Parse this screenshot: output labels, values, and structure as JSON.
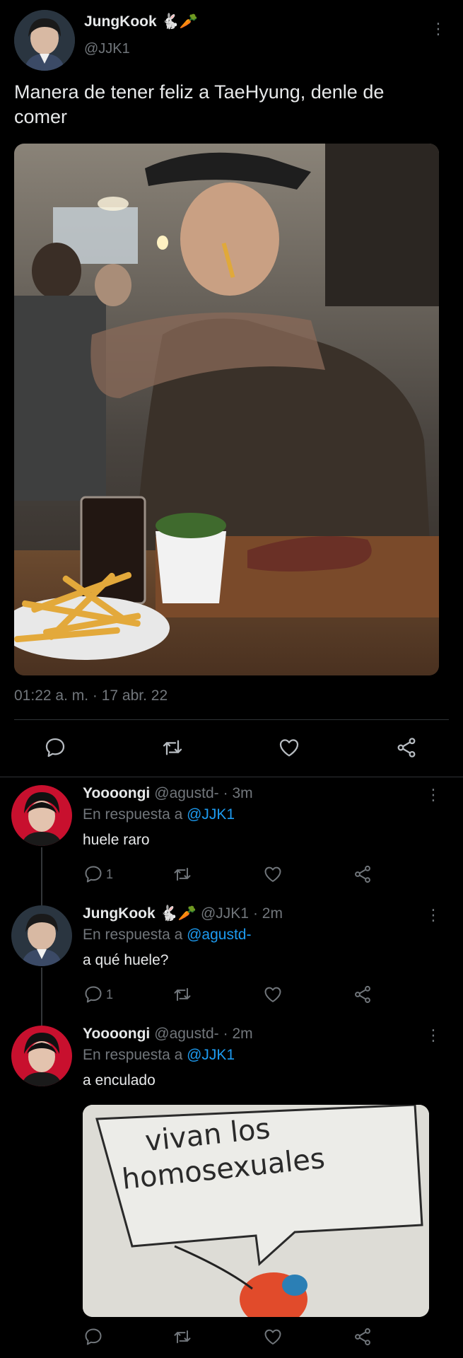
{
  "main_tweet": {
    "display_name": "JungKook",
    "name_emoji": "🐇🥕",
    "handle": "@JJK1",
    "text": "Manera de tener feliz a TaeHyung, denle de comer",
    "timestamp": "01:22 a. m. · 17 abr. 22",
    "more_label": "⋮"
  },
  "replies": [
    {
      "display_name": "Yoooongi",
      "name_emoji": "",
      "handle": "@agustd-",
      "time": "· 3m",
      "reply_prefix": "En respuesta a",
      "reply_to": "@JJK1",
      "text": "huele raro",
      "reply_count": "1",
      "more_label": "⋮"
    },
    {
      "display_name": "JungKook",
      "name_emoji": "🐇🥕",
      "handle": "@JJK1",
      "time": "· 2m",
      "reply_prefix": "En respuesta a",
      "reply_to": "@agustd-",
      "text": "a qué huele?",
      "reply_count": "1",
      "more_label": "⋮"
    },
    {
      "display_name": "Yoooongi",
      "name_emoji": "",
      "handle": "@agustd-",
      "time": "· 2m",
      "reply_prefix": "En respuesta a",
      "reply_to": "@JJK1",
      "text": "a enculado",
      "reply_count": "",
      "more_label": "⋮",
      "meme_text_line1": "vivan los",
      "meme_text_line2": "homosexuales"
    }
  ],
  "colors": {
    "background": "#000000",
    "text": "#e7e9ea",
    "muted": "#71767b",
    "link": "#1d9bf0",
    "divider": "#2f3336"
  }
}
